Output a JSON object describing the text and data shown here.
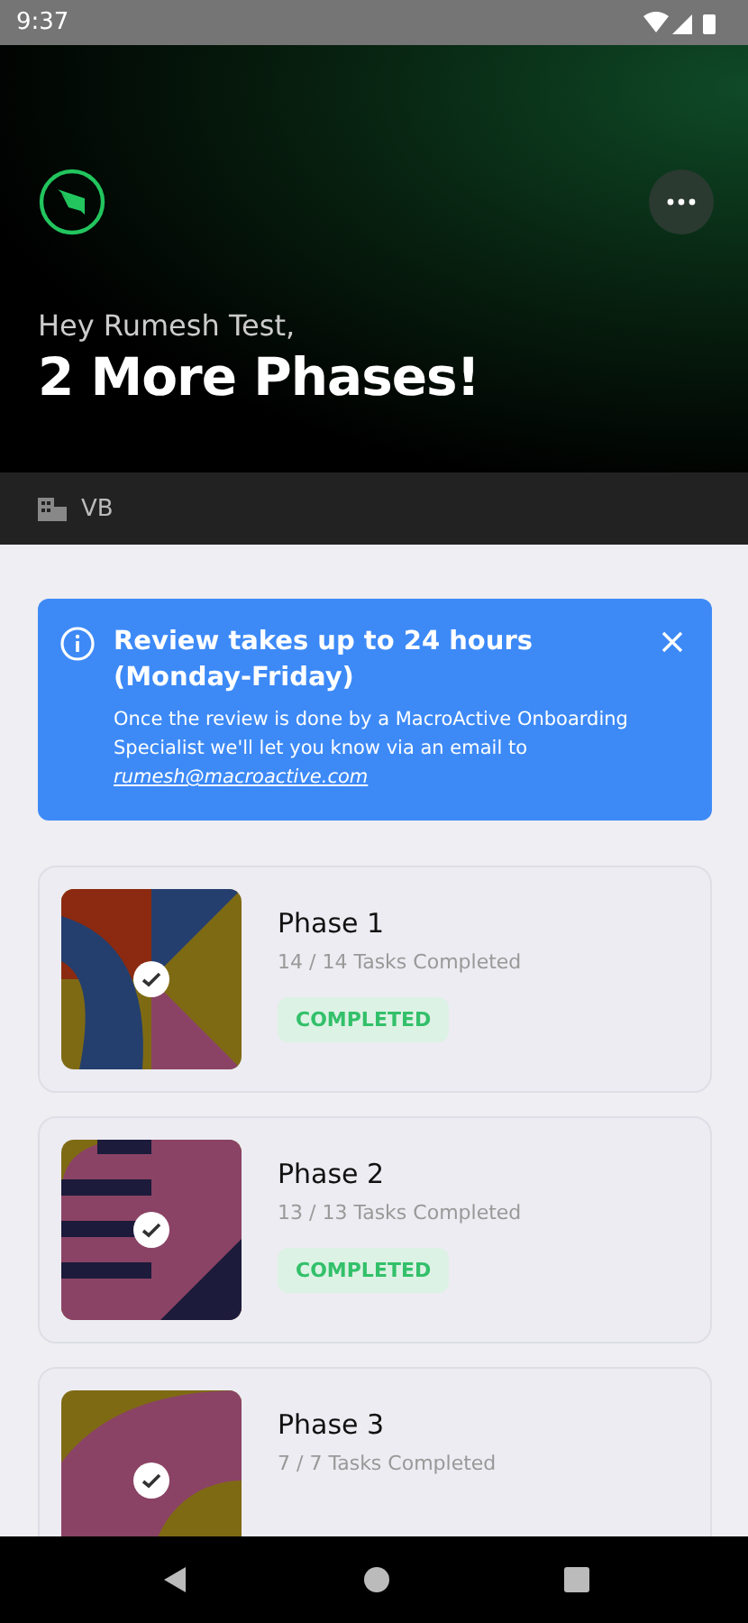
{
  "status_bar": {
    "time": "9:37"
  },
  "header": {
    "greeting": "Hey Rumesh Test,",
    "headline": "2 More Phases!"
  },
  "sub_bar": {
    "label": "VB"
  },
  "alert": {
    "title": "Review takes up to 24 hours (Monday-Friday)",
    "body": "Once the review is done by a MacroActive Onboarding Specialist we'll let you know via an email to",
    "email": "rumesh@macroactive.com"
  },
  "phases": [
    {
      "title": "Phase 1",
      "progress": "14 / 14 Tasks Completed",
      "completed": true,
      "status": "COMPLETED"
    },
    {
      "title": "Phase 2",
      "progress": "13 / 13 Tasks Completed",
      "completed": true,
      "status": "COMPLETED"
    },
    {
      "title": "Phase 3",
      "progress": "7 / 7 Tasks Completed",
      "completed": true
    }
  ]
}
